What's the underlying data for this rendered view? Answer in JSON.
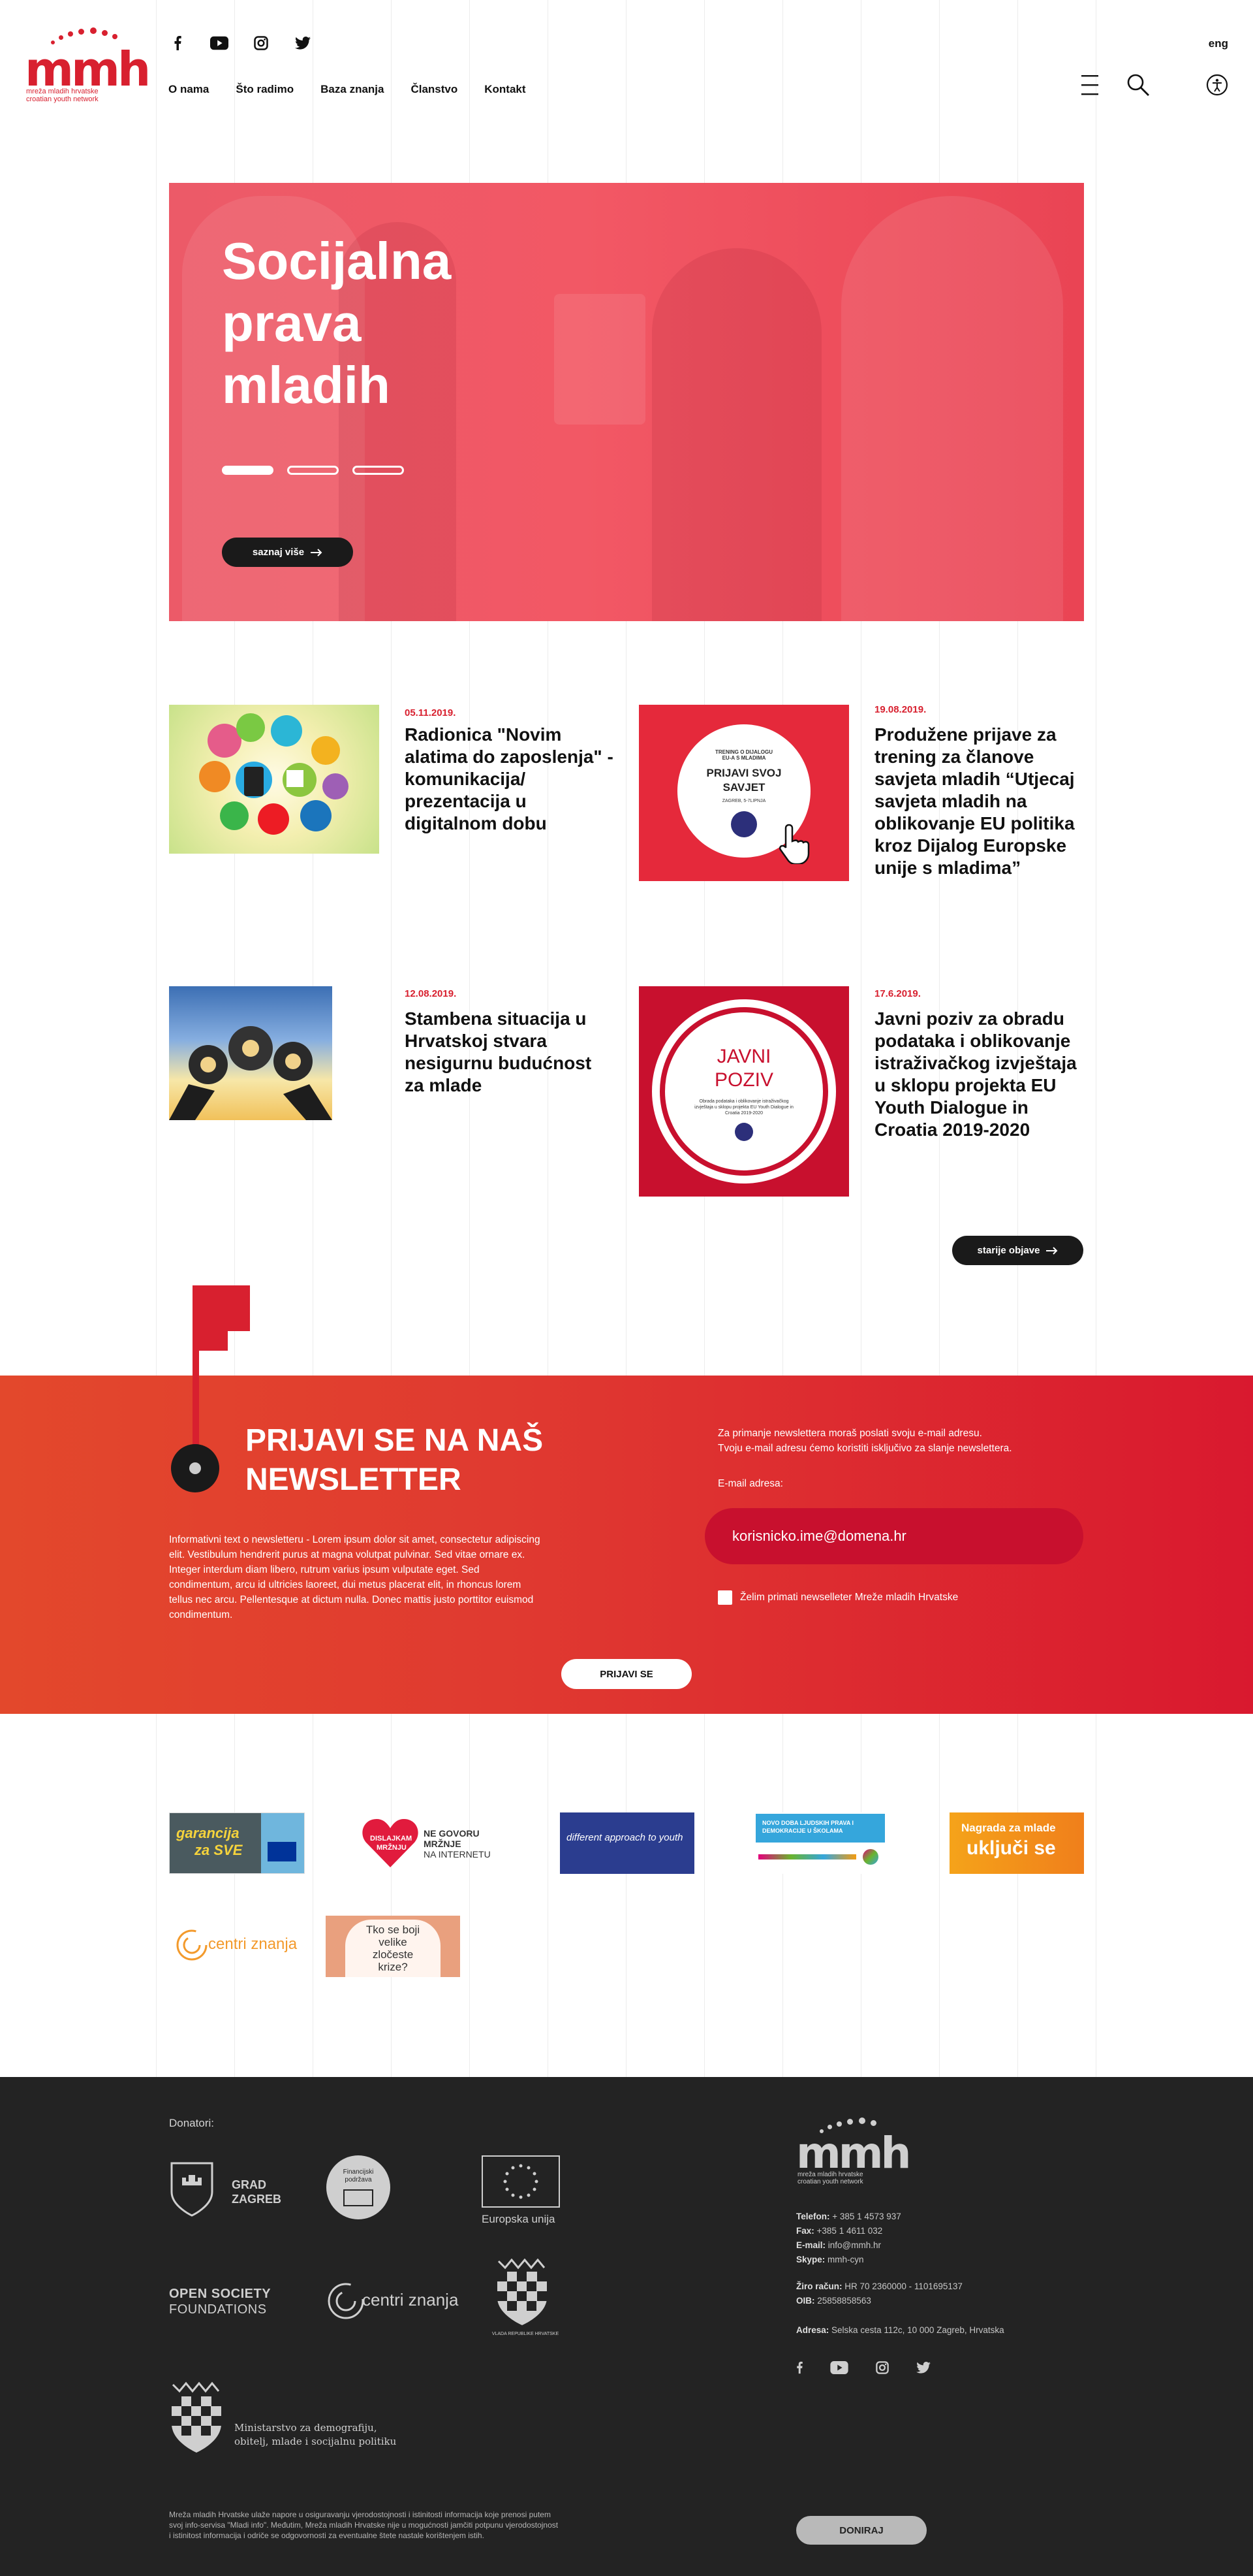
{
  "header": {
    "logo_text": "mmh",
    "logo_subtitle_1": "mreža mladih hrvatske",
    "logo_subtitle_2": "croatian youth network",
    "lang": "eng",
    "nav": [
      "O nama",
      "Što radimo",
      "Baza znanja",
      "Članstvo",
      "Kontakt"
    ],
    "social_icons": [
      "facebook-icon",
      "youtube-icon",
      "instagram-icon",
      "twitter-icon"
    ],
    "right_icons": [
      "menu-icon",
      "search-icon",
      "accessibility-icon"
    ]
  },
  "hero": {
    "title_lines": [
      "Socijalna",
      "prava",
      "mladih"
    ],
    "slides": 3,
    "active_slide": 1,
    "button_label": "saznaj više"
  },
  "articles": [
    {
      "date": "05.11.2019.",
      "title": "Radionica \"Novim alatima do zaposlenja\" - komunikacija/ prezentacija u digitalnom dobu"
    },
    {
      "date": "19.08.2019.",
      "title": "Produžene prijave za trening za članove savjeta mladih “Utjecaj savjeta mladih na oblikovanje EU politika kroz Dijalog Europske unije s mladima”",
      "image_text": {
        "line1": "TRENING O DIJALOGU",
        "line2": "EU-A S MLADIMA",
        "big1": "PRIJAVI SVOJ",
        "big2": "SAVJET",
        "small": "ZAGREB, 5-7LIPNJA"
      }
    },
    {
      "date": "12.08.2019.",
      "title": "Stambena situacija u Hrvatskoj stvara nesigurnu budućnost za mlade"
    },
    {
      "date": "17.6.2019.",
      "title": "Javni poziv za obradu podataka i oblikovanje istraživačkog izvještaja u sklopu projekta EU Youth Dialogue in Croatia 2019-2020",
      "image_text": {
        "big1": "JAVNI",
        "big2": "POZIV",
        "small": "Obrada podataka i oblikovanje istraživačkog izvještaja u sklopu projekta EU Youth Dialogue in Croatia 2019-2020"
      }
    }
  ],
  "older_button": "starije objave",
  "newsletter": {
    "title_line1": "PRIJAVI SE NA NAŠ",
    "title_line2": "NEWSLETTER",
    "text": "Informativni text o newsletteru - Lorem ipsum dolor sit amet, consectetur adipiscing elit. Vestibulum hendrerit purus at magna volutpat pulvinar. Sed vitae ornare ex. Integer interdum diam libero, rutrum varius ipsum vulputate eget. Sed condimentum, arcu id ultricies laoreet, dui metus placerat elit, in rhoncus lorem tellus nec arcu. Pellentesque at dictum nulla. Donec mattis justo porttitor euismod condimentum.",
    "note_1": "Za primanje newslettera moraš poslati svoju e-mail adresu.",
    "note_2": "Tvoju e-mail adresu ćemo koristiti isključivo za slanje newslettera.",
    "email_label": "E-mail adresa:",
    "email_placeholder": "korisnicko.ime@domena.hr",
    "checkbox_label": "Želim primati newselleter Mreže mladih Hrvatske",
    "submit_label": "PRIJAVI SE"
  },
  "partners": {
    "garancija_1": "garancija",
    "garancija_2": "za SVE",
    "dislajkam_1": "DISLAJKAM",
    "dislajkam_2": "MRŽNJU",
    "ne_govoru_1": "NE GOVORU",
    "ne_govoru_2": "MRŽNJE",
    "ne_govoru_3": "NA INTERNETU",
    "different": "different approach to youth",
    "novo_doba": "NOVO DOBA LJUDSKIH PRAVA I DEMOKRACIJE U ŠKOLAMA",
    "nagrada_1": "Nagrada za mlade",
    "nagrada_2": "uključi se",
    "centri": "centri znanja",
    "tko_1": "Tko se boji",
    "tko_2": "velike",
    "tko_3": "zločeste",
    "tko_4": "krize?"
  },
  "footer": {
    "donors_label": "Donatori:",
    "grad_1": "GRAD",
    "grad_2": "ZAGREB",
    "financijska": "Financijski podržava",
    "eu": "Europska unija",
    "osf_1": "OPEN SOCIETY",
    "osf_2": "FOUNDATIONS",
    "centri": "centri znanja",
    "vlada": "VLADA REPUBLIKE HRVATSKE",
    "ministarstvo_1": "Ministarstvo za demografiju,",
    "ministarstvo_2": "obitelj, mlade i socijalnu politiku",
    "logo_text": "mmh",
    "logo_subtitle_1": "mreža mladih hrvatske",
    "logo_subtitle_2": "croatian youth network",
    "telefon_label": "Telefon:",
    "telefon": "+ 385 1 4573 937",
    "fax_label": "Fax:",
    "fax": "+385 1 4611 032",
    "email_label": "E-mail:",
    "email": "info@mmh.hr",
    "skype_label": "Skype:",
    "skype": "mmh-cyn",
    "ziro_label": "Žiro račun:",
    "ziro": "HR 70 2360000 - 1101695137",
    "oib_label": "OIB:",
    "oib": "25858858563",
    "adresa_label": "Adresa:",
    "adresa": "Selska cesta 112c, 10 000 Zagreb, Hrvatska",
    "disclaimer": "Mreža mladih Hrvatske ulaže napore u osiguravanju vjerodostojnosti i istinitosti informacija koje prenosi putem svoj info-servisa \"Mladi info\". Međutim, Mreža mladih Hrvatske nije u mogućnosti jamčiti potpunu vjerodostojnost i istinitost informacija i odriče se odgovornosti za eventualne štete nastale korištenjem istih.",
    "donate_label": "DONIRAJ"
  }
}
